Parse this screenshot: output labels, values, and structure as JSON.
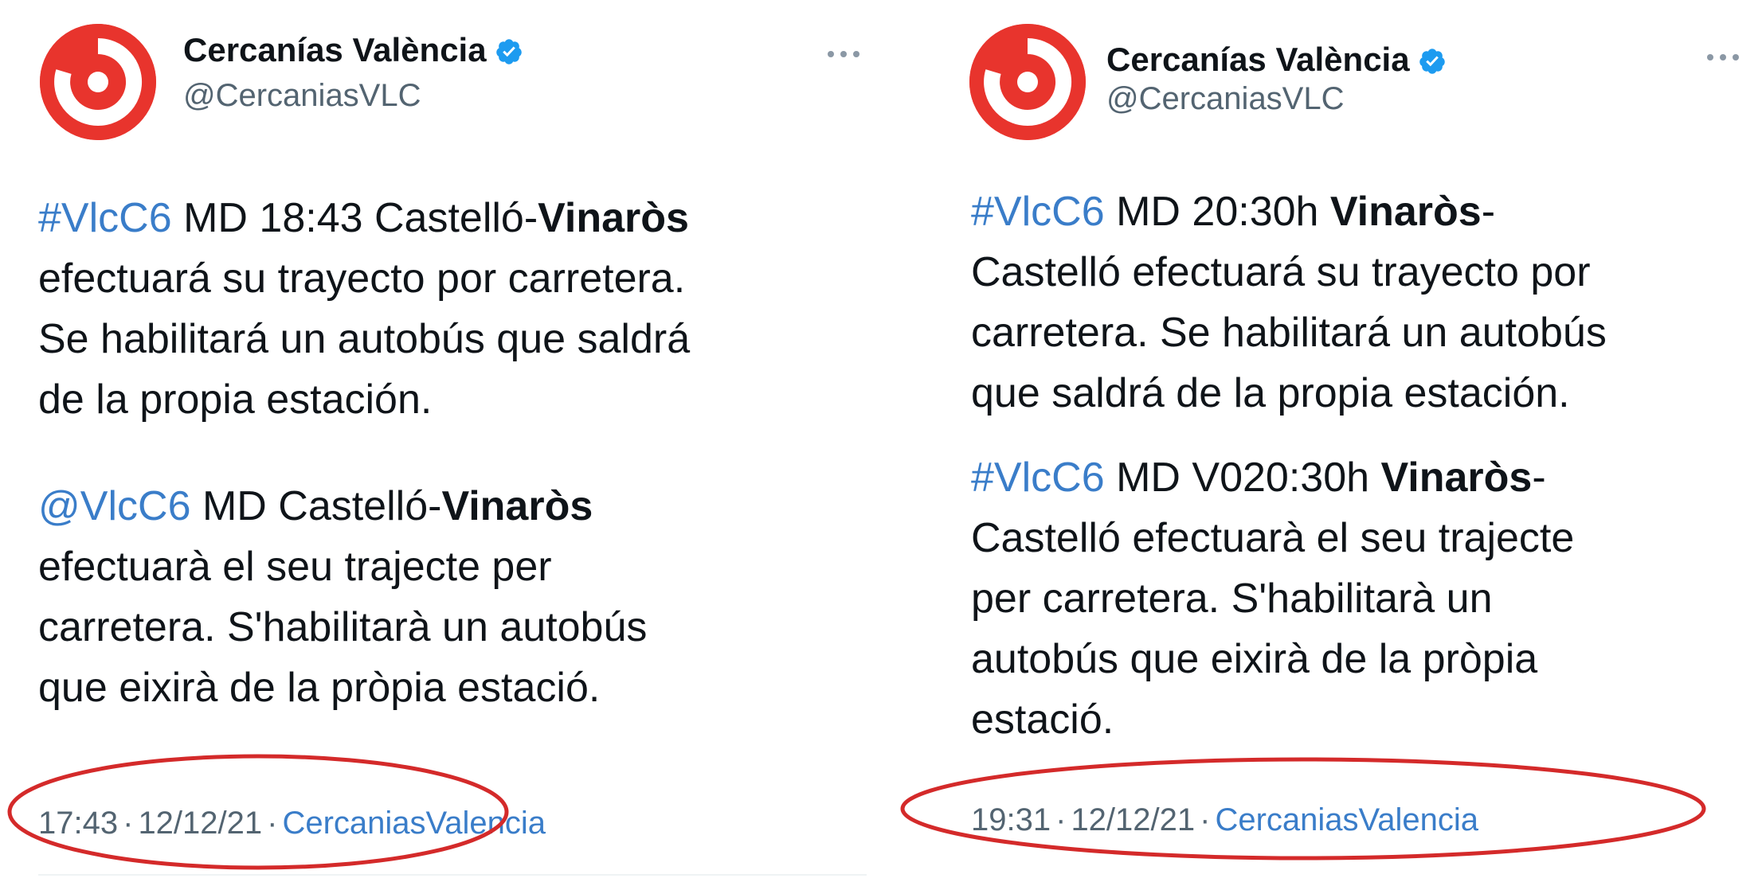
{
  "tweets": [
    {
      "author": {
        "name": "Cercanías València",
        "handle": "@CercaniasVLC",
        "verified": true,
        "avatar_icon": "cercanias-logo-icon"
      },
      "paragraphs": [
        {
          "lines": [
            [
              {
                "text": "#VlcC6",
                "style": "tag"
              },
              {
                "text": " MD 18:43 Castelló-",
                "style": "normal"
              },
              {
                "text": "Vinaròs",
                "style": "bold"
              }
            ],
            [
              {
                "text": "efectuará su trayecto por carretera.",
                "style": "normal"
              }
            ],
            [
              {
                "text": "Se habilitará un autobús que saldrá",
                "style": "normal"
              }
            ],
            [
              {
                "text": "de la propia estación.",
                "style": "normal"
              }
            ]
          ]
        },
        {
          "lines": [
            [
              {
                "text": "@VlcC6",
                "style": "tag"
              },
              {
                "text": " MD Castelló-",
                "style": "normal"
              },
              {
                "text": "Vinaròs",
                "style": "bold"
              }
            ],
            [
              {
                "text": "efectuarà el seu trajecte per",
                "style": "normal"
              }
            ],
            [
              {
                "text": "carretera. S'habilitarà un autobús",
                "style": "normal"
              }
            ],
            [
              {
                "text": "que eixirà de la pròpia estació.",
                "style": "normal"
              }
            ]
          ]
        }
      ],
      "time": "17:43",
      "date": "12/12/21",
      "separator": "·",
      "source": "CercaniasValencia"
    },
    {
      "author": {
        "name": "Cercanías València",
        "handle": "@CercaniasVLC",
        "verified": true,
        "avatar_icon": "cercanias-logo-icon"
      },
      "paragraphs": [
        {
          "lines": [
            [
              {
                "text": "#VlcC6",
                "style": "tag"
              },
              {
                "text": " MD 20:30h ",
                "style": "normal"
              },
              {
                "text": "Vinaròs",
                "style": "bold"
              },
              {
                "text": "-",
                "style": "normal"
              }
            ],
            [
              {
                "text": "Castelló efectuará su trayecto por",
                "style": "normal"
              }
            ],
            [
              {
                "text": "carretera. Se habilitará un autobús",
                "style": "normal"
              }
            ],
            [
              {
                "text": "que saldrá de la propia estación.",
                "style": "normal"
              }
            ]
          ]
        },
        {
          "lines": [
            [
              {
                "text": "#VlcC6",
                "style": "tag"
              },
              {
                "text": " MD V020:30h ",
                "style": "normal"
              },
              {
                "text": "Vinaròs",
                "style": "bold"
              },
              {
                "text": "-",
                "style": "normal"
              }
            ],
            [
              {
                "text": "Castelló efectuarà el seu trajecte",
                "style": "normal"
              }
            ],
            [
              {
                "text": "per carretera. S'habilitarà un",
                "style": "normal"
              }
            ],
            [
              {
                "text": "autobús que eixirà de la pròpia",
                "style": "normal"
              }
            ],
            [
              {
                "text": "estació.",
                "style": "normal"
              }
            ]
          ]
        }
      ],
      "time": "19:31",
      "date": "12/12/21",
      "separator": "·",
      "source": "CercaniasValencia"
    }
  ],
  "colors": {
    "brand_red": "#e8342d",
    "link_blue": "#3a7dc9",
    "verified_blue": "#1d9bf0",
    "meta_gray": "#536471",
    "annotation_red": "#d42a2a"
  },
  "icons": {
    "verified": "verified-badge-icon",
    "more": "more-options-icon"
  }
}
